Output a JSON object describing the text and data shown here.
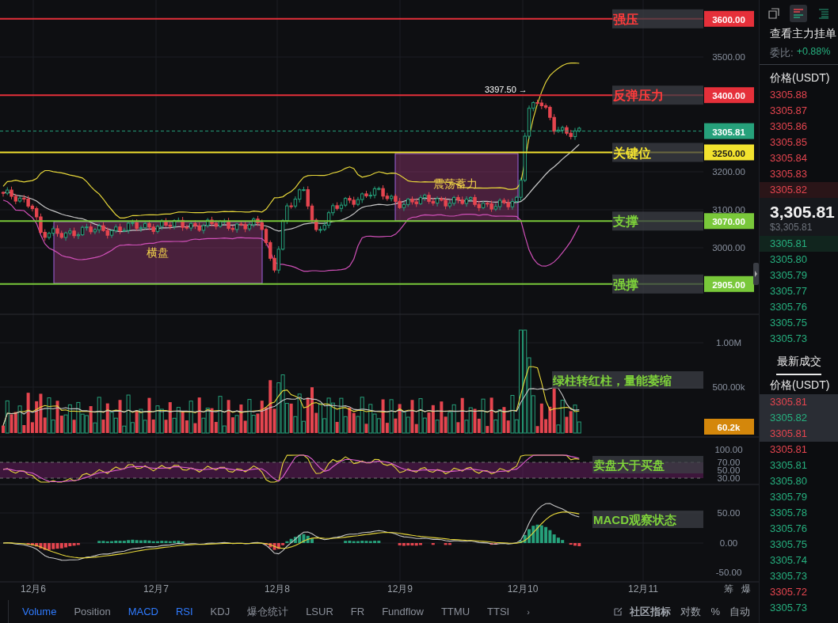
{
  "price_chart": {
    "levels": [
      {
        "label": "强压",
        "value": "3600.00",
        "kind": "resistance"
      },
      {
        "label": "反弹压力",
        "value": "3400.00",
        "kind": "resistance"
      },
      {
        "label": "关键位",
        "value": "3250.00",
        "kind": "key"
      },
      {
        "label": "支撑",
        "value": "3070.00",
        "kind": "support"
      },
      {
        "label": "强撑",
        "value": "2905.00",
        "kind": "support"
      }
    ],
    "axis_labels": [
      "3500.00",
      "3200.00",
      "3100.00",
      "3000.00"
    ],
    "current_price": "3305.81",
    "high_marker": "3397.50 →",
    "zones": [
      {
        "label": "横盘"
      },
      {
        "label": "震荡蓄力"
      }
    ]
  },
  "volume_panel": {
    "axis_labels": [
      "1.00M",
      "500.00k"
    ],
    "current": "60.2k",
    "note": "绿柱转红柱，量能萎缩"
  },
  "rsi_panel": {
    "axis_labels": [
      "100.00",
      "70.00",
      "50.00",
      "30.00"
    ],
    "note": "卖盘大于买盘"
  },
  "macd_panel": {
    "axis_labels": [
      "50.00",
      "0.00",
      "-50.00"
    ],
    "note": "MACD观察状态"
  },
  "time_axis": [
    "12月6",
    "12月7",
    "12月8",
    "12月9",
    "12月10",
    "12月11"
  ],
  "side_labels": [
    "筹",
    "爆"
  ],
  "indicator_tabs": [
    {
      "label": "Volume",
      "selected": true
    },
    {
      "label": "Position",
      "selected": false
    },
    {
      "label": "MACD",
      "selected": true
    },
    {
      "label": "RSI",
      "selected": true
    },
    {
      "label": "KDJ",
      "selected": false
    },
    {
      "label": "爆仓统计",
      "selected": false
    },
    {
      "label": "LSUR",
      "selected": false
    },
    {
      "label": "FR",
      "selected": false
    },
    {
      "label": "Fundflow",
      "selected": false
    },
    {
      "label": "TTMU",
      "selected": false
    },
    {
      "label": "TTSI",
      "selected": false
    }
  ],
  "more_tabs": "›",
  "right_tools": [
    {
      "label": "社区指标",
      "kind": "community"
    },
    {
      "label": "对数",
      "kind": "plain"
    },
    {
      "label": "%",
      "kind": "plain"
    },
    {
      "label": "自动",
      "kind": "plain"
    }
  ],
  "view_buttons": [
    {
      "kind": "split",
      "selected": false
    },
    {
      "kind": "book",
      "selected": true
    },
    {
      "kind": "list",
      "selected": false
    }
  ],
  "order_book": {
    "link": "查看主力挂单",
    "ratio_label": "委比:",
    "ratio": "+0.88%",
    "header": "价格(USDT)",
    "asks": [
      {
        "price": "3305.88",
        "highlighted": false
      },
      {
        "price": "3305.87",
        "highlighted": false
      },
      {
        "price": "3305.86",
        "highlighted": false
      },
      {
        "price": "3305.85",
        "highlighted": false
      },
      {
        "price": "3305.84",
        "highlighted": false
      },
      {
        "price": "3305.83",
        "highlighted": false
      },
      {
        "price": "3305.82",
        "highlighted": true
      }
    ],
    "last_price": "3,305.81",
    "last_price_usd": "$3,305.81",
    "bids": [
      {
        "price": "3305.81",
        "highlighted": true
      },
      {
        "price": "3305.80",
        "highlighted": false
      },
      {
        "price": "3305.79",
        "highlighted": false
      },
      {
        "price": "3305.77",
        "highlighted": false
      },
      {
        "price": "3305.76",
        "highlighted": false
      },
      {
        "price": "3305.75",
        "highlighted": false
      },
      {
        "price": "3305.73",
        "highlighted": false
      }
    ]
  },
  "trades": {
    "tab": "最新成交",
    "header": "价格(USDT)",
    "rows": [
      {
        "price": "3305.81",
        "color": "#e5454f",
        "highlighted": true
      },
      {
        "price": "3305.82",
        "color": "#26b07f",
        "highlighted": true
      },
      {
        "price": "3305.81",
        "color": "#e5454f",
        "highlighted": true
      },
      {
        "price": "3305.81",
        "color": "#e5454f",
        "highlighted": false
      },
      {
        "price": "3305.81",
        "color": "#26b07f",
        "highlighted": false
      },
      {
        "price": "3305.80",
        "color": "#26b07f",
        "highlighted": false
      },
      {
        "price": "3305.79",
        "color": "#26b07f",
        "highlighted": false
      },
      {
        "price": "3305.78",
        "color": "#26b07f",
        "highlighted": false
      },
      {
        "price": "3305.76",
        "color": "#26b07f",
        "highlighted": false
      },
      {
        "price": "3305.75",
        "color": "#26b07f",
        "highlighted": false
      },
      {
        "price": "3305.74",
        "color": "#26b07f",
        "highlighted": false
      },
      {
        "price": "3305.73",
        "color": "#26b07f",
        "highlighted": false
      },
      {
        "price": "3305.72",
        "color": "#e5454f",
        "highlighted": false
      },
      {
        "price": "3305.73",
        "color": "#26b07f",
        "highlighted": false
      }
    ]
  }
}
